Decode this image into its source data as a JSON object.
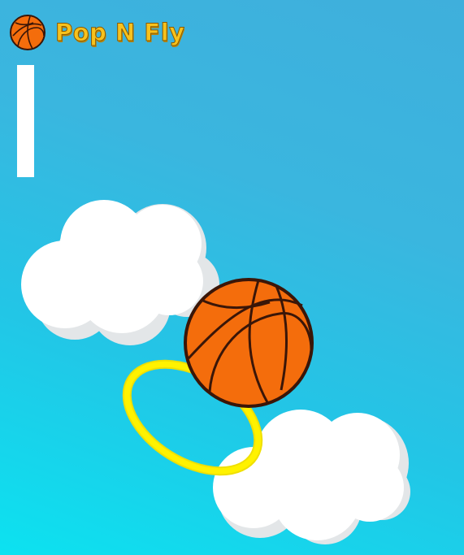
{
  "game": {
    "title": "Pop N Fly"
  },
  "hud": {
    "logo_icon": "basketball-icon",
    "power_meter_fraction": 1.0
  },
  "scene": {
    "sky_colors": [
      "#3fafdc",
      "#0ce2f0"
    ],
    "ball_color": "#f46d0c",
    "ball_seam_color": "#3a1608",
    "hoop_color": "#fff200",
    "cloud_color": "#ffffff",
    "cloud_shadow_color": "#e3e6e8"
  }
}
